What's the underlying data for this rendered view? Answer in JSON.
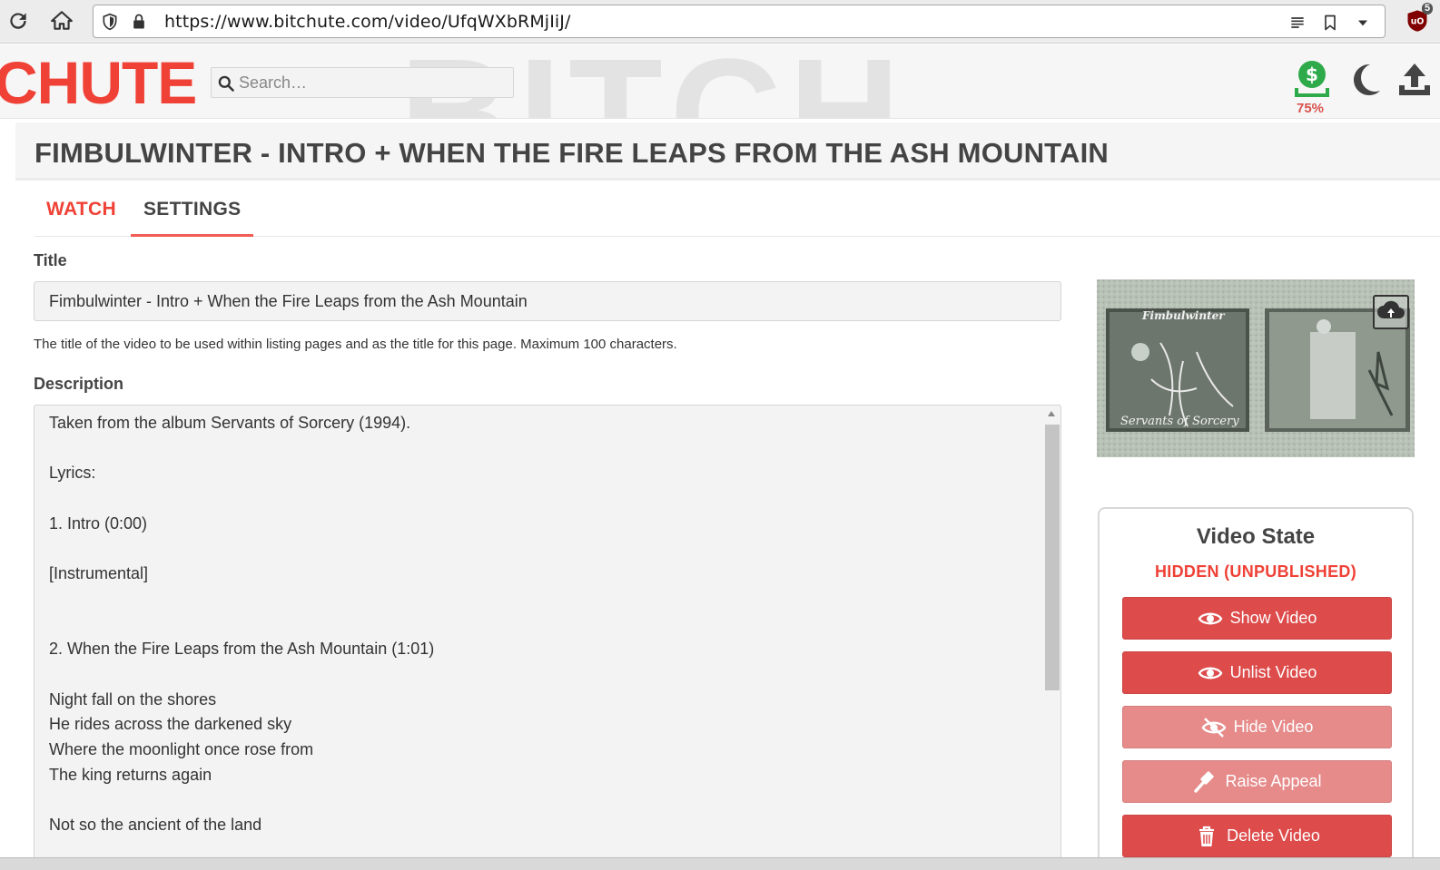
{
  "browser": {
    "url": "https://www.bitchute.com/video/UfqWXbRMjIiJ/",
    "extension_badge": "5"
  },
  "header": {
    "logo_text": "CHUTE",
    "background_letters": "BITCH",
    "search_placeholder": "Search…",
    "tip_percent": "75%"
  },
  "page": {
    "title": "FIMBULWINTER - INTRO + WHEN THE FIRE LEAPS FROM THE ASH MOUNTAIN",
    "tabs": [
      {
        "label": "WATCH"
      },
      {
        "label": "SETTINGS"
      }
    ]
  },
  "form": {
    "title_label": "Title",
    "title_value": "Fimbulwinter - Intro + When the Fire Leaps from the Ash Mountain",
    "title_help": "The title of the video to be used within listing pages and as the title for this page. Maximum 100 characters.",
    "description_label": "Description",
    "description_value": "Taken from the album Servants of Sorcery (1994).\n\nLyrics:\n\n1. Intro (0:00)\n\n[Instrumental]\n\n\n2. When the Fire Leaps from the Ash Mountain (1:01)\n\nNight fall on the shores\nHe rides across the darkened sky\nWhere the moonlight once rose from\nThe king returns again\n\nNot so the ancient of the land"
  },
  "thumbnail": {
    "album_text": "Fimbulwinter",
    "album_subtitle": "Servants of Sorcery"
  },
  "video_state": {
    "heading": "Video State",
    "status": "HIDDEN (UNPUBLISHED)",
    "buttons": [
      {
        "label": "Show Video",
        "icon": "eye-icon"
      },
      {
        "label": "Unlist Video",
        "icon": "eye-icon"
      },
      {
        "label": "Hide Video",
        "icon": "eye-slash-icon"
      },
      {
        "label": "Raise Appeal",
        "icon": "gavel-icon"
      },
      {
        "label": "Delete Video",
        "icon": "trash-icon"
      }
    ]
  },
  "colors": {
    "brand_red": "#ef4136",
    "button_red": "#dd4b4b",
    "button_faded": "#e68a8a",
    "tip_green": "#2eaa4a"
  }
}
